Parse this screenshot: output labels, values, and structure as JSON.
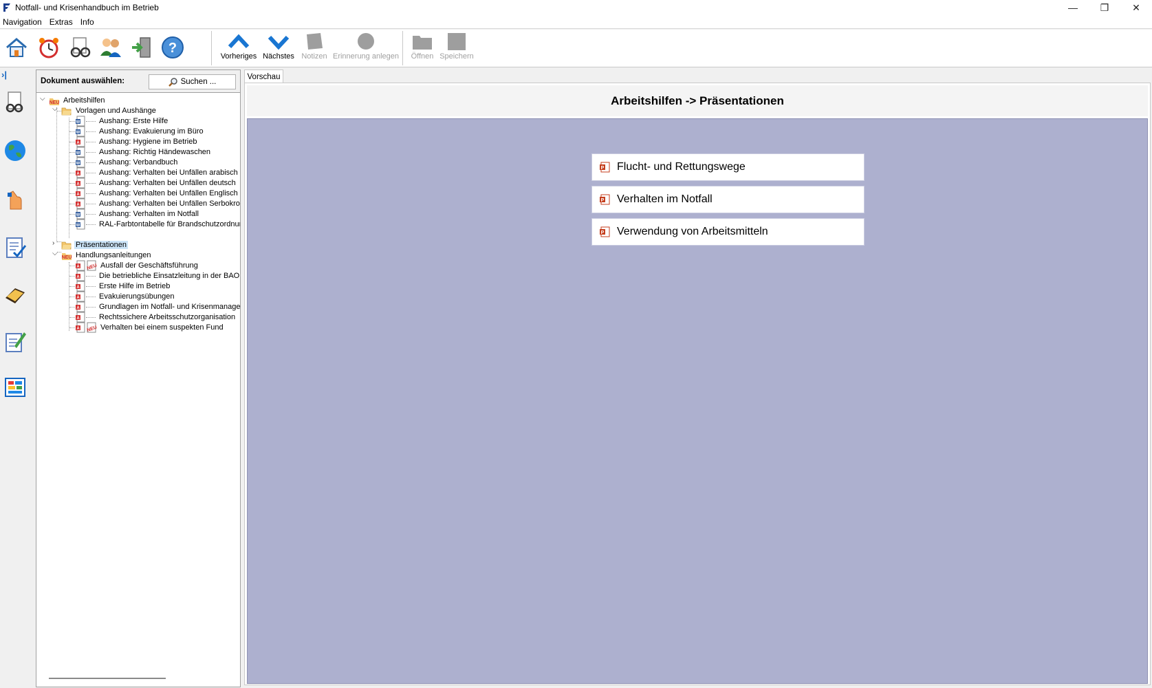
{
  "window": {
    "title": "Notfall- und Krisenhandbuch im Betrieb",
    "minimize": "—",
    "maximize": "❐",
    "close": "✕"
  },
  "menu": [
    "Navigation",
    "Extras",
    "Info"
  ],
  "toolbar": {
    "icons": [
      "home-icon",
      "alarm-clock-icon",
      "glasses-icon",
      "users-icon",
      "exit-door-icon",
      "help-icon"
    ],
    "nav": [
      {
        "label": "Vorheriges",
        "enabled": true
      },
      {
        "label": "Nächstes",
        "enabled": true
      },
      {
        "label": "Notizen",
        "enabled": false
      },
      {
        "label": "Erinnerung anlegen",
        "enabled": false
      }
    ],
    "file": [
      {
        "label": "Öffnen",
        "enabled": false
      },
      {
        "label": "Speichern",
        "enabled": false
      }
    ]
  },
  "sidebar": {
    "collapse": "›|",
    "icons": [
      "document-glasses-icon",
      "globe-icon",
      "hand-icon",
      "checklist-icon",
      "book-icon",
      "edit-note-icon",
      "chart-board-icon"
    ]
  },
  "tree": {
    "header_label": "Dokument auswählen:",
    "search_label": "Suchen ...",
    "root": "Arbeitshilfen",
    "group1": "Vorlagen und Aushänge",
    "group1_items": [
      {
        "label": "Aushang: Erste Hilfe",
        "type": "word"
      },
      {
        "label": "Aushang: Evakuierung im Büro",
        "type": "word"
      },
      {
        "label": "Aushang: Hygiene im Betrieb",
        "type": "pdf"
      },
      {
        "label": "Aushang: Richtig Händewaschen",
        "type": "word"
      },
      {
        "label": "Aushang: Verbandbuch",
        "type": "word"
      },
      {
        "label": "Aushang: Verhalten bei Unfällen arabisch",
        "type": "pdf"
      },
      {
        "label": "Aushang: Verhalten bei Unfällen deutsch",
        "type": "pdf"
      },
      {
        "label": "Aushang: Verhalten bei Unfällen Englisch",
        "type": "pdf"
      },
      {
        "label": "Aushang: Verhalten bei Unfällen Serbokroatisch",
        "type": "pdf"
      },
      {
        "label": "Aushang: Verhalten im Notfall",
        "type": "word"
      },
      {
        "label": "RAL-Farbtontabelle für Brandschutzordnung",
        "type": "word"
      }
    ],
    "group2": "Präsentationen",
    "group3": "Handlungsanleitungen",
    "group3_items": [
      {
        "label": "Ausfall der Geschäftsführung",
        "type": "pdf",
        "new": true
      },
      {
        "label": "Die betriebliche Einsatzleitung in der BAO",
        "type": "pdf",
        "new": false
      },
      {
        "label": "Erste Hilfe im Betrieb",
        "type": "pdf",
        "new": false
      },
      {
        "label": "Evakuierungsübungen",
        "type": "pdf",
        "new": false
      },
      {
        "label": "Grundlagen im Notfall- und Krisenmanagement",
        "type": "pdf",
        "new": false
      },
      {
        "label": "Rechtssichere Arbeitsschutzorganisation",
        "type": "pdf",
        "new": false
      },
      {
        "label": "Verhalten bei einem suspekten Fund",
        "type": "pdf",
        "new": true
      }
    ]
  },
  "content": {
    "tab": "Vorschau",
    "heading": "Arbeitshilfen -> Präsentationen",
    "presentations": [
      "Flucht- und Rettungswege",
      "Verhalten im Notfall",
      "Verwendung von Arbeitsmitteln"
    ]
  }
}
